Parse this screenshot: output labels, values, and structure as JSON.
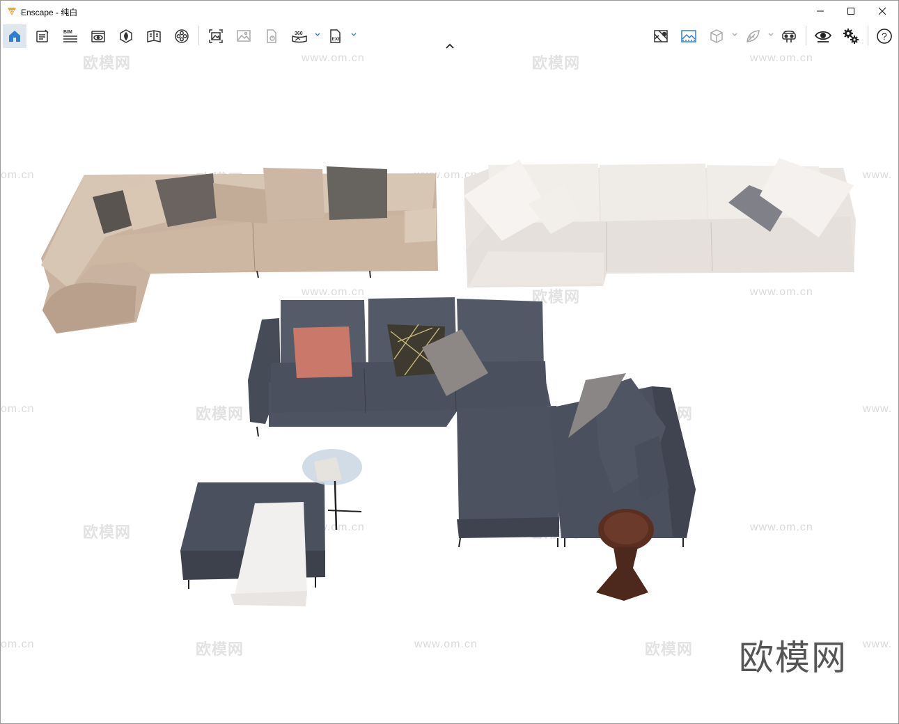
{
  "window": {
    "title": "Enscape - 纯白",
    "controls": {
      "minimize": "minimize-icon",
      "maximize": "maximize-icon",
      "close": "close-icon"
    }
  },
  "toolbar": {
    "left_icons": [
      "home-icon",
      "notes-icon",
      "bim-icon",
      "visual-settings-icon",
      "asset-library-icon",
      "section-views-icon",
      "material-editor-icon",
      "screenshot-icon",
      "image-gallery-icon",
      "batch-render-icon",
      "panorama-360-icon",
      "export-exe-icon"
    ],
    "bim_label": "BIM",
    "pano_label": "360",
    "exe_label": "EXE",
    "right_icons": [
      "map-icon",
      "landscape-image-icon",
      "cube-view-icon",
      "leaf-icon",
      "vr-headset-icon",
      "eye-icon",
      "settings-gears-icon",
      "help-icon"
    ],
    "help_label": "?"
  },
  "viewport": {
    "watermark_cn": "欧模网",
    "watermark_url": "www.om.cn",
    "watermark_edge": "om.cn",
    "watermark_edge_right": "www.",
    "corner_logo": "欧模网"
  },
  "colors": {
    "accent_blue": "#2d7fd0",
    "beige_sofa": "#cdb8a4",
    "white_sofa": "#ece8e4",
    "grey_sofa": "#4c5260",
    "walnut_table": "#5a2f22"
  }
}
